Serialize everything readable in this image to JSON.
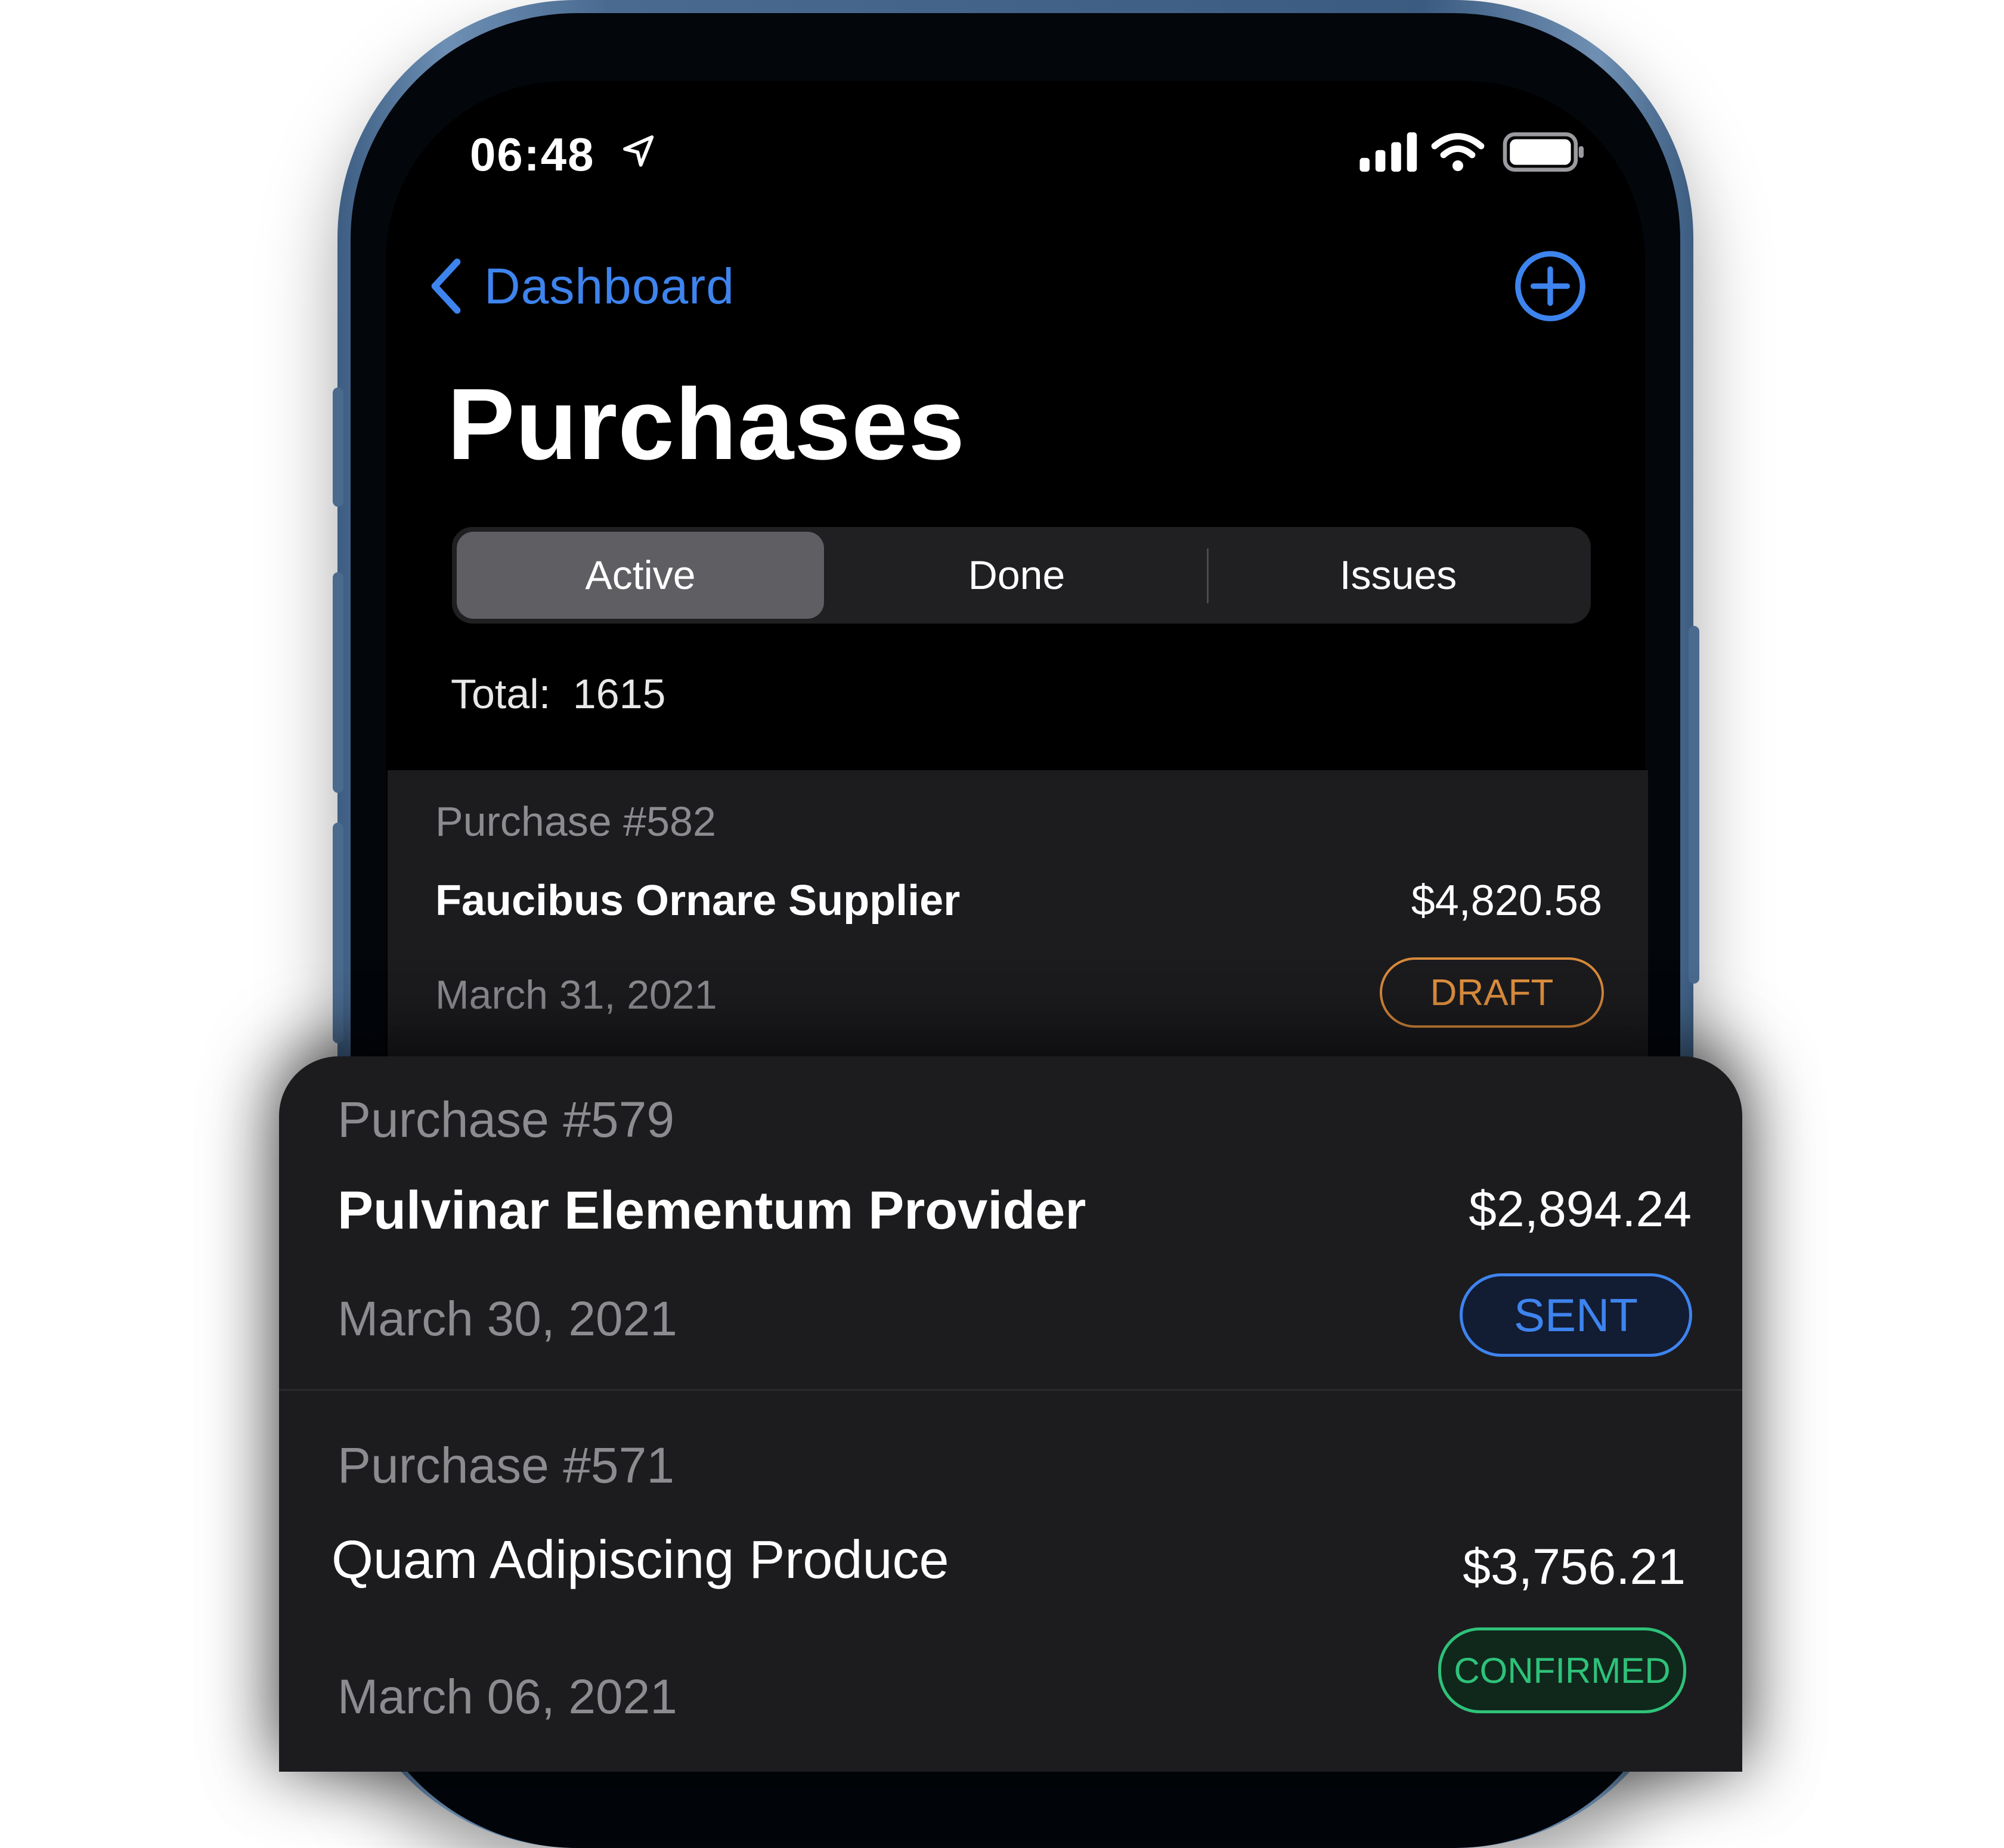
{
  "status_bar": {
    "time": "06:48"
  },
  "nav": {
    "back_label": "Dashboard"
  },
  "page": {
    "title": "Purchases"
  },
  "segments": [
    {
      "label": "Active",
      "selected": true
    },
    {
      "label": "Done",
      "selected": false
    },
    {
      "label": "Issues",
      "selected": false
    }
  ],
  "summary": {
    "total_label": "Total:",
    "total_value": "1615"
  },
  "purchases": [
    {
      "number": "Purchase #582",
      "supplier": "Faucibus Ornare Supplier",
      "amount": "$4,820.58",
      "date": "March 31, 2021",
      "status": "DRAFT",
      "status_color": "#d98a3a"
    },
    {
      "number": "Purchase #579",
      "supplier": "Pulvinar Elementum Provider",
      "amount": "$2,894.24",
      "date": "March 30, 2021",
      "status": "SENT",
      "status_color": "#3e84ee"
    },
    {
      "number": "Purchase #571",
      "supplier": "Quam Adipiscing Produce",
      "amount": "$3,756.21",
      "date": "March 06, 2021",
      "status": "CONFIRMED",
      "status_color": "#2ec279"
    }
  ],
  "colors": {
    "accent": "#3e84ee",
    "background": "#000000",
    "card": "#1c1c1f"
  },
  "icons": {
    "back": "chevron-left-icon",
    "add": "plus-circle-icon",
    "location": "location-arrow-icon",
    "signal": "cellular-signal-icon",
    "wifi": "wifi-icon",
    "battery": "battery-icon"
  }
}
